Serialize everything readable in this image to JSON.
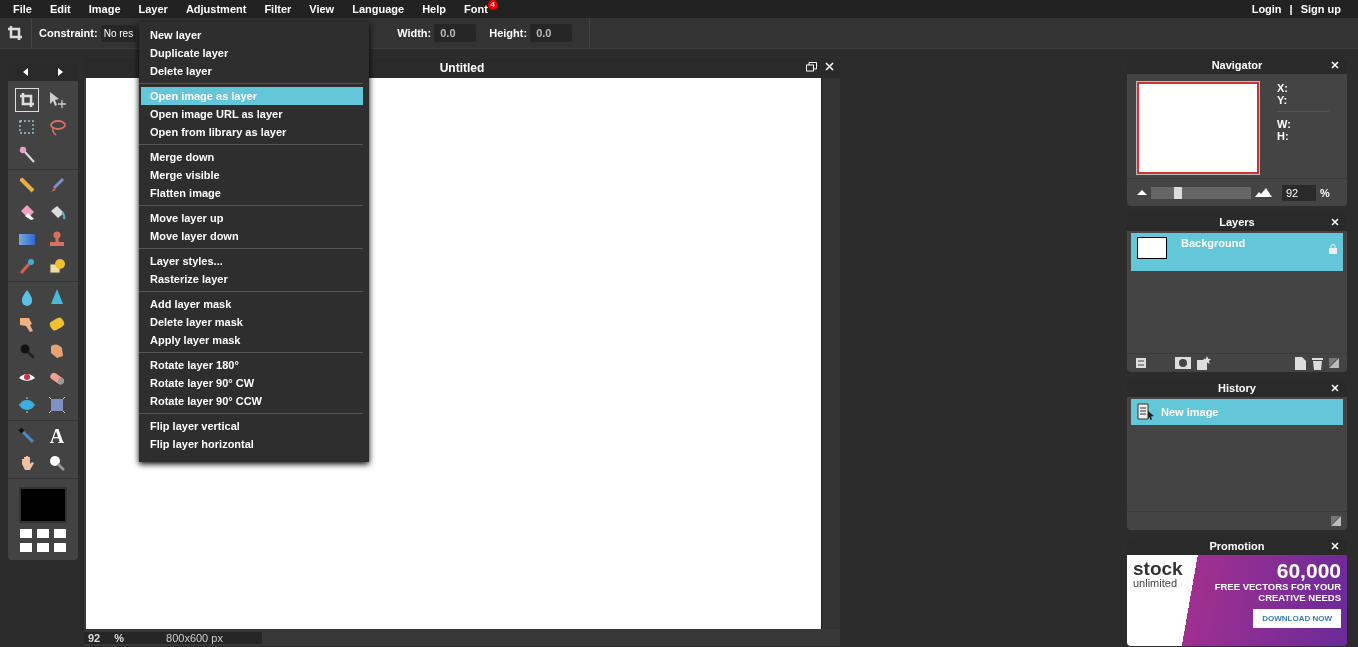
{
  "menubar": {
    "items": [
      {
        "label": "File"
      },
      {
        "label": "Edit"
      },
      {
        "label": "Image"
      },
      {
        "label": "Layer"
      },
      {
        "label": "Adjustment"
      },
      {
        "label": "Filter"
      },
      {
        "label": "View"
      },
      {
        "label": "Language"
      },
      {
        "label": "Help"
      },
      {
        "label": "Font",
        "badge": "4"
      }
    ],
    "account": {
      "login": "Login",
      "separator": "|",
      "signup": "Sign up"
    }
  },
  "toolbar": {
    "constraint_label": "Constraint:",
    "constraint_value": "No res",
    "width_label": "Width:",
    "width_value": "0.0",
    "height_label": "Height:",
    "height_value": "0.0"
  },
  "layer_menu": {
    "groups": [
      {
        "items": [
          {
            "label": "New layer",
            "selected": false
          },
          {
            "label": "Duplicate layer",
            "selected": false
          },
          {
            "label": "Delete layer",
            "selected": false
          }
        ]
      },
      {
        "items": [
          {
            "label": "Open image as layer",
            "selected": true
          },
          {
            "label": "Open image URL as layer",
            "selected": false
          },
          {
            "label": "Open from library as layer",
            "selected": false
          }
        ]
      },
      {
        "items": [
          {
            "label": "Merge down",
            "selected": false
          },
          {
            "label": "Merge visible",
            "selected": false
          },
          {
            "label": "Flatten image",
            "selected": false
          }
        ]
      },
      {
        "items": [
          {
            "label": "Move layer up",
            "selected": false
          },
          {
            "label": "Move layer down",
            "selected": false
          }
        ]
      },
      {
        "items": [
          {
            "label": "Layer styles...",
            "selected": false
          },
          {
            "label": "Rasterize layer",
            "selected": false
          }
        ]
      },
      {
        "items": [
          {
            "label": "Add layer mask",
            "selected": false
          },
          {
            "label": "Delete layer mask",
            "selected": false
          },
          {
            "label": "Apply layer mask",
            "selected": false
          }
        ]
      },
      {
        "items": [
          {
            "label": "Rotate layer 180°",
            "selected": false
          },
          {
            "label": "Rotate layer 90° CW",
            "selected": false
          },
          {
            "label": "Rotate layer 90° CCW",
            "selected": false
          }
        ]
      },
      {
        "items": [
          {
            "label": "Flip layer vertical",
            "selected": false
          },
          {
            "label": "Flip layer horizontal",
            "selected": false
          }
        ]
      }
    ]
  },
  "tools": {
    "groups": [
      {
        "items": [
          {
            "kind": "icon",
            "selected": true
          },
          {
            "kind": "icon",
            "selected": false
          },
          {
            "kind": "icon",
            "selected": false
          },
          {
            "kind": "icon",
            "selected": false
          },
          {
            "kind": "icon",
            "selected": false
          }
        ]
      },
      {
        "items": [
          {
            "kind": "icon",
            "selected": false
          },
          {
            "kind": "icon",
            "selected": false
          },
          {
            "kind": "icon",
            "selected": false
          },
          {
            "kind": "icon",
            "selected": false
          },
          {
            "kind": "icon",
            "selected": false
          },
          {
            "kind": "icon",
            "selected": false
          },
          {
            "kind": "icon",
            "selected": false
          },
          {
            "kind": "icon",
            "selected": false
          }
        ]
      },
      {
        "items": [
          {
            "kind": "icon",
            "selected": false
          },
          {
            "kind": "icon",
            "selected": false
          },
          {
            "kind": "icon",
            "selected": false
          },
          {
            "kind": "icon",
            "selected": false
          },
          {
            "kind": "icon",
            "selected": false
          },
          {
            "kind": "icon",
            "selected": false
          },
          {
            "kind": "icon",
            "selected": false
          },
          {
            "kind": "icon",
            "selected": false
          },
          {
            "kind": "icon",
            "selected": false
          },
          {
            "kind": "icon",
            "selected": false
          }
        ]
      },
      {
        "items": [
          {
            "kind": "icon",
            "selected": false
          },
          {
            "kind": "glyph",
            "glyph": "A",
            "selected": false
          },
          {
            "kind": "icon",
            "selected": false
          },
          {
            "kind": "icon",
            "selected": false
          }
        ]
      }
    ],
    "foreground": {
      "color": "#000000"
    }
  },
  "document": {
    "title": "Untitled",
    "zoom": "92",
    "zoom_unit": "%",
    "size": "800x600 px"
  },
  "navigator": {
    "title": "Navigator",
    "labels": [
      "X:",
      "Y:",
      "W:",
      "H:"
    ],
    "zoom_slider": {
      "level": 0.25
    },
    "zoom_value": "92",
    "zoom_unit": "%"
  },
  "layers": {
    "title": "Layers",
    "items": [
      {
        "name": "Background",
        "selected": true,
        "locked": true
      }
    ]
  },
  "history": {
    "title": "History",
    "items": [
      {
        "label": "New image",
        "selected": true
      }
    ]
  },
  "promotion": {
    "title": "Promotion",
    "brand": "stock",
    "brand_sub": "unlimited",
    "headline": "60,000",
    "tagline": "FREE VECTORS FOR YOUR CREATIVE NEEDS",
    "cta": "DOWNLOAD NOW"
  }
}
